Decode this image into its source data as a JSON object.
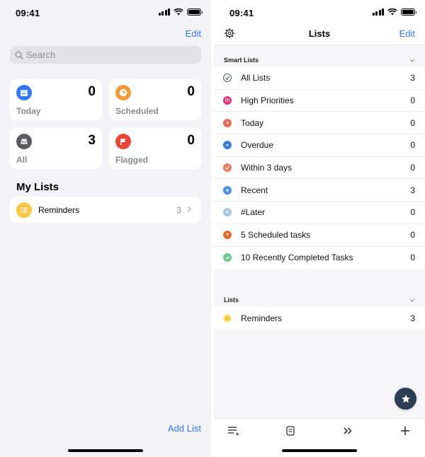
{
  "left": {
    "status_time": "09:41",
    "edit_label": "Edit",
    "search": {
      "placeholder": "Search",
      "value": ""
    },
    "cards": {
      "today": {
        "label": "Today",
        "count": "0",
        "color": "#3478f6"
      },
      "scheduled": {
        "label": "Scheduled",
        "count": "0",
        "color": "#f19a37"
      },
      "all": {
        "label": "All",
        "count": "3",
        "color": "#5b5b60"
      },
      "flagged": {
        "label": "Flagged",
        "count": "0",
        "color": "#e9473a"
      }
    },
    "my_lists_heading": "My Lists",
    "lists": [
      {
        "name": "Reminders",
        "count": "3",
        "color": "#f7c744"
      }
    ],
    "add_list_label": "Add List"
  },
  "right": {
    "status_time": "09:41",
    "title": "Lists",
    "edit_label": "Edit",
    "smart_lists_heading": "Smart Lists",
    "smart_lists": [
      {
        "name": "All Lists",
        "count": "3",
        "color": "#56606b",
        "icon": "check-circle-icon"
      },
      {
        "name": "High Priorities",
        "count": "0",
        "color": "#e2337a",
        "icon": "exclamation-icon"
      },
      {
        "name": "Today",
        "count": "0",
        "color": "#e26d5c",
        "icon": "clock-icon"
      },
      {
        "name": "Overdue",
        "count": "0",
        "color": "#3a7bd5",
        "icon": "minus-icon"
      },
      {
        "name": "Within 3 days",
        "count": "0",
        "color": "#ec7a63",
        "icon": "check-icon"
      },
      {
        "name": "Recent",
        "count": "3",
        "color": "#4a8fe7",
        "icon": "plus-icon"
      },
      {
        "name": "#Later",
        "count": "0",
        "color": "#a7c4e4",
        "icon": "hash-icon"
      },
      {
        "name": "5 Scheduled tasks",
        "count": "0",
        "color": "#e0692f",
        "icon": "clock-icon"
      },
      {
        "name": "10 Recently Completed Tasks",
        "count": "0",
        "color": "#6cc68a",
        "icon": "check-icon"
      }
    ],
    "lists_heading": "Lists",
    "lists": [
      {
        "name": "Reminders",
        "count": "3",
        "color": "#f7c744"
      }
    ],
    "tabbar_icons": [
      "list-add-icon",
      "note-icon",
      "chevrons-right-icon",
      "plus-icon"
    ],
    "fab_icon": "star-icon",
    "accent": "#3478f6"
  }
}
